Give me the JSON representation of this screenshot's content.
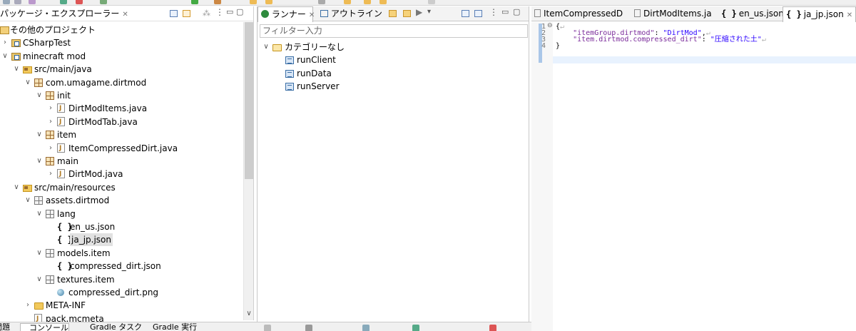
{
  "colors": {
    "selection": "#e1e1e1",
    "string": "#2a00ff",
    "key": "#7a2a9a",
    "ruler": "#aac7e8"
  },
  "package_explorer": {
    "tab_label": "パッケージ・エクスプローラー",
    "items": [
      {
        "label": "その他のプロジェクト",
        "icon": "working-set-icon",
        "twisty": ""
      },
      {
        "label": "CSharpTest",
        "icon": "project-icon",
        "twisty": ">"
      },
      {
        "label": "minecraft mod",
        "icon": "project-icon",
        "twisty": "v"
      },
      {
        "label": "src/main/java",
        "icon": "source-folder-icon",
        "twisty": "v"
      },
      {
        "label": "com.umagame.dirtmod",
        "icon": "package-icon",
        "twisty": "v"
      },
      {
        "label": "init",
        "icon": "package-icon",
        "twisty": "v"
      },
      {
        "label": "DirtModItems.java",
        "icon": "java-file-icon",
        "twisty": ">"
      },
      {
        "label": "DirtModTab.java",
        "icon": "java-file-icon",
        "twisty": ">"
      },
      {
        "label": "item",
        "icon": "package-icon",
        "twisty": "v"
      },
      {
        "label": "ItemCompressedDirt.java",
        "icon": "java-file-icon",
        "twisty": ">"
      },
      {
        "label": "main",
        "icon": "package-icon",
        "twisty": "v"
      },
      {
        "label": "DirtMod.java",
        "icon": "java-file-icon",
        "twisty": ">"
      },
      {
        "label": "src/main/resources",
        "icon": "source-folder-icon",
        "twisty": "v"
      },
      {
        "label": "assets.dirtmod",
        "icon": "resource-package-icon",
        "twisty": "v"
      },
      {
        "label": "lang",
        "icon": "resource-package-icon",
        "twisty": "v"
      },
      {
        "label": "en_us.json",
        "icon": "json-file-icon",
        "twisty": ""
      },
      {
        "label": "ja_jp.json",
        "icon": "json-file-icon",
        "twisty": "",
        "selected": true
      },
      {
        "label": "models.item",
        "icon": "resource-package-icon",
        "twisty": "v"
      },
      {
        "label": "compressed_dirt.json",
        "icon": "json-file-icon",
        "twisty": ""
      },
      {
        "label": "textures.item",
        "icon": "resource-package-icon",
        "twisty": "v"
      },
      {
        "label": "compressed_dirt.png",
        "icon": "png-file-icon",
        "twisty": ""
      },
      {
        "label": "META-INF",
        "icon": "folder-icon",
        "twisty": ">"
      },
      {
        "label": "pack.mcmeta",
        "icon": "file-icon",
        "twisty": ""
      }
    ]
  },
  "runner": {
    "tab_label": "ランナー",
    "outline_tab_label": "アウトライン",
    "filter_placeholder": "フィルター入力",
    "category_label": "カテゴリーなし",
    "launches": [
      "runClient",
      "runData",
      "runServer"
    ]
  },
  "editor": {
    "tabs": [
      {
        "label": "ItemCompressedD",
        "icon": "java-file-icon"
      },
      {
        "label": "DirtModItems.ja",
        "icon": "java-file-icon"
      },
      {
        "label": "en_us.json",
        "icon": "json-file-icon"
      },
      {
        "label": "ja_jp.json",
        "icon": "json-file-icon",
        "active": true
      }
    ],
    "line_numbers": [
      "1",
      "2",
      "3",
      "4"
    ],
    "line1": "{",
    "line2_key": "\"itemGroup.dirtmod\"",
    "line2_sep": ": ",
    "line2_val": "\"DirtMod\"",
    "line2_tail": ",",
    "line3_key": "\"item.dirtmod.compressed_dirt\"",
    "line3_sep": ": ",
    "line3_val": "\"圧縮された土\"",
    "line4": "}",
    "eol_marker": "↵"
  },
  "bottom": {
    "tabs": [
      "問題",
      "コンソール",
      "Gradle タスク",
      "Gradle 実行"
    ]
  }
}
